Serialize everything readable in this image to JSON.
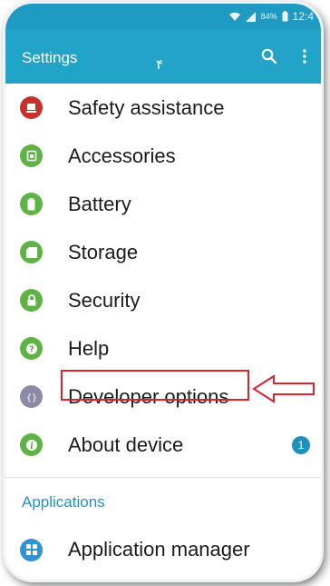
{
  "status_bar": {
    "battery_percent": "84%",
    "time": "12:4"
  },
  "app_bar": {
    "title": "Settings",
    "marker": "۴"
  },
  "settings_items": [
    {
      "label": "Safety assistance",
      "icon": "safety-icon",
      "color": "#c8302c"
    },
    {
      "label": "Accessories",
      "icon": "accessories-icon",
      "color": "#5fb244"
    },
    {
      "label": "Battery",
      "icon": "battery-icon",
      "color": "#5fb244"
    },
    {
      "label": "Storage",
      "icon": "storage-icon",
      "color": "#5fb244"
    },
    {
      "label": "Security",
      "icon": "lock-icon",
      "color": "#5fb244"
    },
    {
      "label": "Help",
      "icon": "help-icon",
      "color": "#5fb244"
    },
    {
      "label": "Developer options",
      "icon": "code-braces-icon",
      "color": "#8a8aa6"
    },
    {
      "label": "About device",
      "icon": "info-icon",
      "color": "#5fb244",
      "badge": "1"
    }
  ],
  "applications": {
    "header": "Applications",
    "items": [
      {
        "label": "Application manager",
        "icon": "grid-icon",
        "color": "#2f93d6"
      }
    ]
  },
  "annotation": {
    "highlighted_item": "Developer options",
    "color": "#d9232d"
  }
}
